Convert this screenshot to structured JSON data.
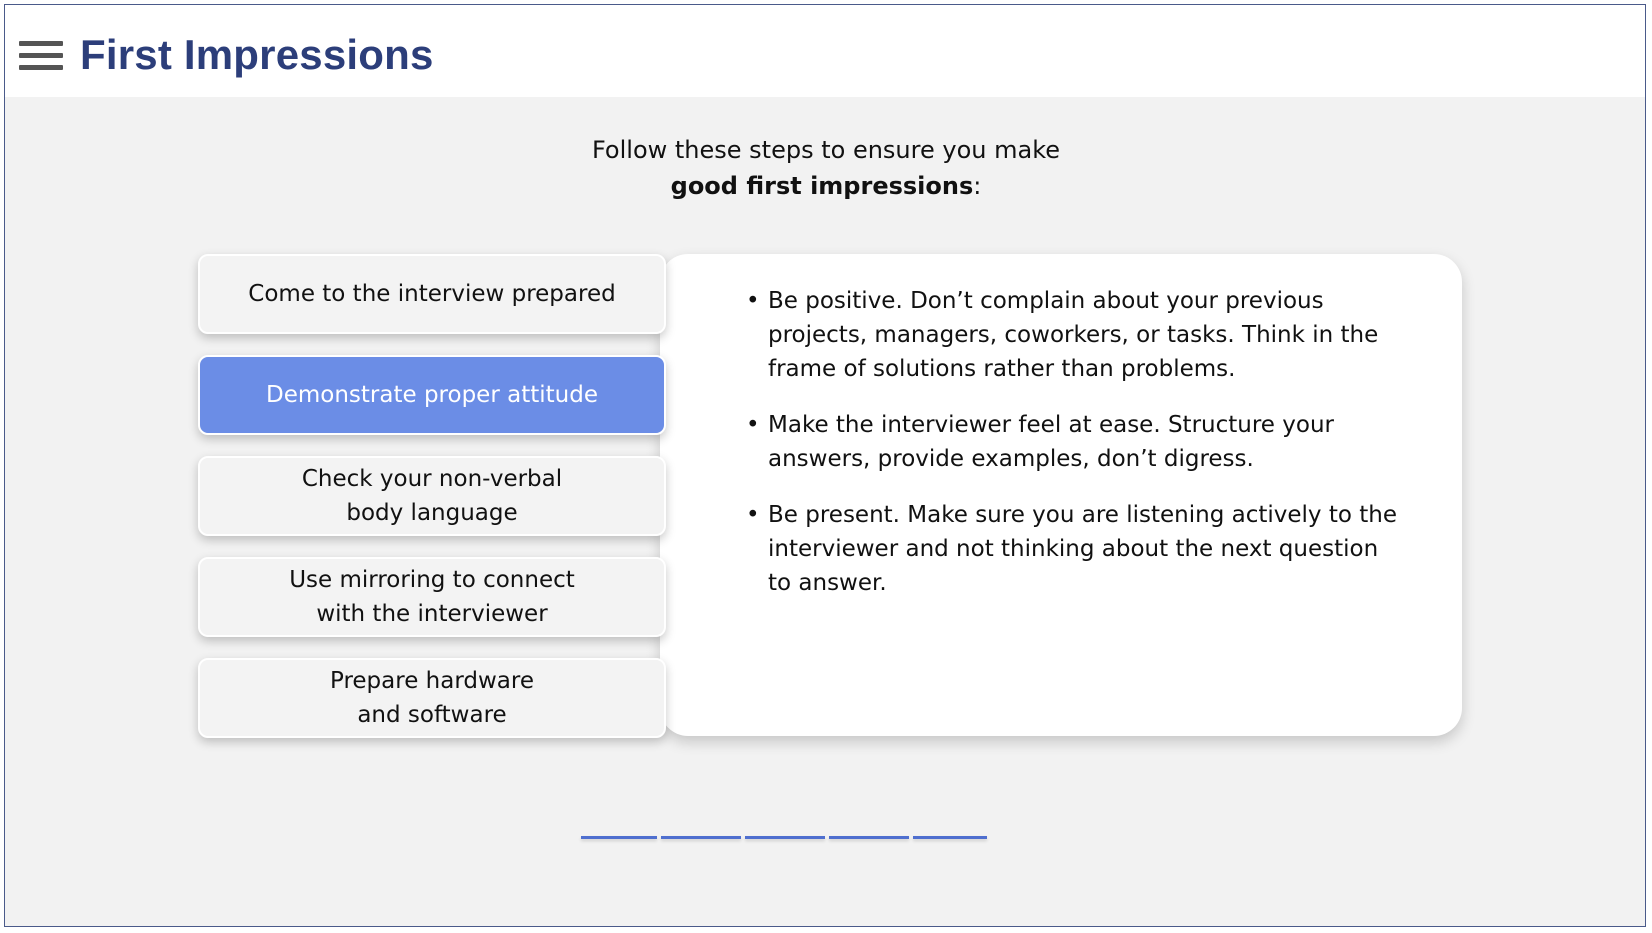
{
  "header": {
    "title": "First Impressions",
    "menu_icon": "hamburger-menu-icon"
  },
  "intro": {
    "line1": "Follow these steps to ensure you make",
    "bold": "good first impressions",
    "suffix": ":"
  },
  "steps": [
    {
      "label": "Come to the interview prepared",
      "active": false
    },
    {
      "label": "Demonstrate proper attitude",
      "active": true
    },
    {
      "label": "Check your non-verbal\nbody language",
      "active": false
    },
    {
      "label": "Use mirroring to connect\nwith the interviewer",
      "active": false
    },
    {
      "label": "Prepare hardware\nand software",
      "active": false
    }
  ],
  "details": {
    "bullets": [
      "Be positive. Don’t complain about your previous projects, managers, coworkers, or tasks. Think in the frame of solutions rather than problems.",
      "Make the interviewer feel at ease. Structure your answers, provide examples, don’t digress.",
      "Be present. Make sure you are listening actively to the interviewer and not thinking about the next question to answer."
    ]
  },
  "progress": {
    "segments": 5
  },
  "colors": {
    "title": "#2c3e7a",
    "active_step": "#6b8de6",
    "progress": "#4f6fcf",
    "background": "#f2f2f2"
  }
}
